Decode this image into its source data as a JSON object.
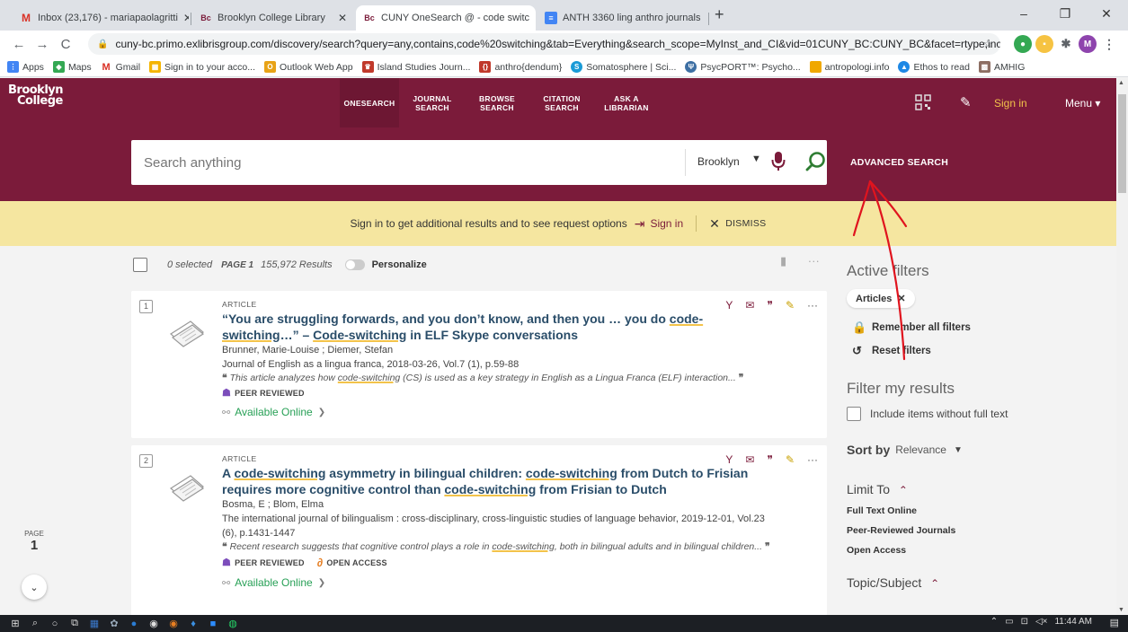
{
  "browser": {
    "tabs": [
      {
        "icon": "gmail-icon",
        "label": "Inbox (23,176) - mariapaolagritti"
      },
      {
        "icon": "bc-icon",
        "label": "Brooklyn College Library"
      },
      {
        "icon": "bc-icon",
        "label": "CUNY OneSearch @ - code switc"
      },
      {
        "icon": "docs-icon",
        "label": "ANTH 3360 ling anthro journals"
      }
    ],
    "url": "cuny-bc.primo.exlibrisgroup.com/discovery/search?query=any,contains,code%20switching&tab=Everything&search_scope=MyInst_and_CI&vid=01CUNY_BC:CUNY_BC&facet=rtype,include,a...",
    "profile_initial": "M",
    "bookmarks": [
      {
        "icon": "apps-icon",
        "label": "Apps"
      },
      {
        "icon": "maps-icon",
        "label": "Maps"
      },
      {
        "icon": "gmail-icon",
        "label": "Gmail"
      },
      {
        "icon": "google-icon",
        "label": "Sign in to your acco..."
      },
      {
        "icon": "outlook-icon",
        "label": "Outlook Web App"
      },
      {
        "icon": "journal-icon",
        "label": "Island Studies Journ..."
      },
      {
        "icon": "anthro-icon",
        "label": "anthro{dendum}"
      },
      {
        "icon": "somato-icon",
        "label": "Somatosphere | Sci..."
      },
      {
        "icon": "psyc-icon",
        "label": "PsycPORT™: Psycho..."
      },
      {
        "icon": "folder-icon",
        "label": "antropologi.info"
      },
      {
        "icon": "ethos-icon",
        "label": "Ethos to read"
      },
      {
        "icon": "amhig-icon",
        "label": "AMHIG"
      }
    ]
  },
  "site": {
    "logo_line1": "Brooklyn",
    "logo_line2": "College",
    "nav": [
      "ONESEARCH",
      "JOURNAL\nSEARCH",
      "BROWSE\nSEARCH",
      "CITATION\nSEARCH",
      "ASK A\nLIBRARIAN"
    ],
    "signin": "Sign in",
    "menu": "Menu ▾"
  },
  "search": {
    "placeholder": "Search anything",
    "scope": "Brooklyn",
    "advanced": "ADVANCED SEARCH"
  },
  "notice": {
    "text": "Sign in to get additional results and to see request options",
    "signin": "Sign in",
    "dismiss": "DISMISS"
  },
  "results_bar": {
    "selected": "0 selected",
    "page": "PAGE 1",
    "count": "155,972 Results",
    "personalize": "Personalize"
  },
  "results": [
    {
      "num": "1",
      "type": "ARTICLE",
      "title_html": "“You are struggling forwards, and you don’t know, and then you … you do <span class=\"hl\">code-switching</span>…” – <span class=\"hl\">Code-switching</span> in ELF Skype conversations",
      "authors": "Brunner, Marie-Louise ; Diemer, Stefan",
      "pubinfo": "Journal of English as a lingua franca, 2018-03-26, Vol.7 (1), p.59-88",
      "snippet_html": "This article analyzes how <span class=\"hl\">code-switching</span> (CS) is used as a key strategy in English as a Lingua Franca (ELF) interaction...",
      "peer": "PEER REVIEWED",
      "open_access": "",
      "available": "Available Online"
    },
    {
      "num": "2",
      "type": "ARTICLE",
      "title_html": "A <span class=\"hl\">code-switching</span> asymmetry in bilingual children: <span class=\"hl\">code-switching</span> from Dutch to Frisian requires more cognitive control than <span class=\"hl\">code-switching</span> from Frisian to Dutch",
      "authors": "Bosma, E ; Blom, Elma",
      "pubinfo": "The international journal of bilingualism : cross-disciplinary, cross-linguistic studies of language behavior, 2019-12-01, Vol.23 (6), p.1431-1447",
      "snippet_html": "Recent research suggests that cognitive control plays a role in <span class=\"hl\">code-switching</span>, both in bilingual adults and in bilingual children...",
      "peer": "PEER REVIEWED",
      "open_access": "OPEN ACCESS",
      "available": "Available Online"
    }
  ],
  "pager": {
    "label": "PAGE",
    "value": "1"
  },
  "filters": {
    "active_title": "Active filters",
    "chip": "Articles",
    "remember": "Remember all filters",
    "reset": "Reset filters",
    "filter_title": "Filter my results",
    "include": "Include items without full text",
    "sort_label": "Sort by",
    "sort_value": "Relevance",
    "limit_title": "Limit To",
    "limits": [
      "Full Text Online",
      "Peer-Reviewed Journals",
      "Open Access"
    ],
    "topic_title": "Topic/Subject"
  },
  "taskbar": {
    "time": "11:44 AM"
  },
  "colors": {
    "brand": "#7b1b3a",
    "notice": "#f5e6a0",
    "link": "#2a4d69",
    "available": "#27a056",
    "annotation": "#e0141e"
  }
}
